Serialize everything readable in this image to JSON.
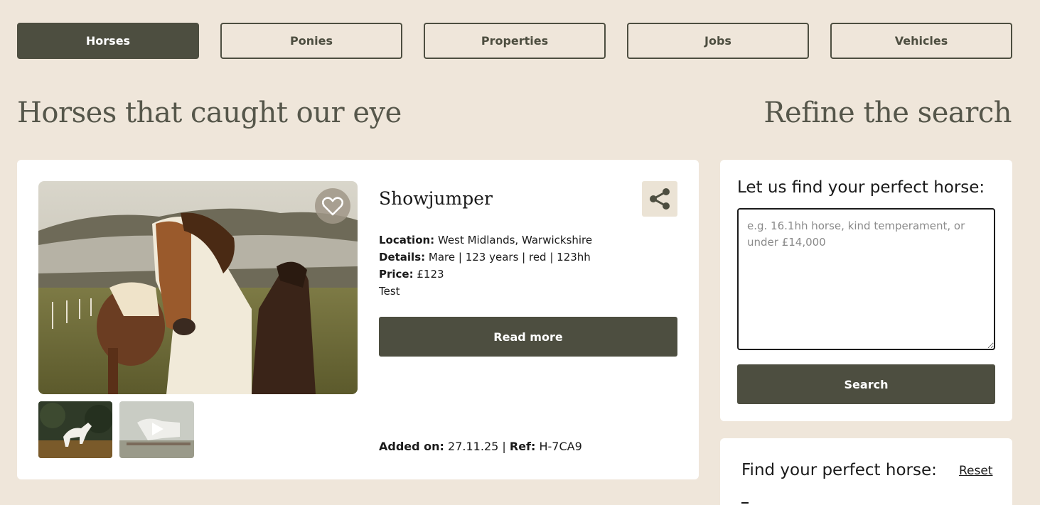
{
  "tabs": [
    {
      "label": "Horses",
      "active": true
    },
    {
      "label": "Ponies",
      "active": false
    },
    {
      "label": "Properties",
      "active": false
    },
    {
      "label": "Jobs",
      "active": false
    },
    {
      "label": "Vehicles",
      "active": false
    }
  ],
  "headings": {
    "left": "Horses that caught our eye",
    "right": "Refine the search"
  },
  "listing": {
    "title": "Showjumper",
    "location_label": "Location:",
    "location": "West Midlands, Warwickshire",
    "details_label": "Details:",
    "details": "Mare | 123 years | red | 123hh",
    "price_label": "Price:",
    "price": "£123",
    "note": "Test",
    "read_more": "Read more",
    "added_label": "Added on:",
    "added": "27.11.25",
    "separator": "|",
    "ref_label": "Ref:",
    "ref": "H-7CA9",
    "icons": {
      "favourite": "heart-icon",
      "share": "share-icon",
      "play": "play-icon"
    }
  },
  "search": {
    "title": "Let us find your perfect horse:",
    "placeholder": "e.g. 16.1hh horse, kind temperament, or under £14,000",
    "button": "Search"
  },
  "filter": {
    "title": "Find your perfect horse:",
    "reset": "Reset"
  },
  "colors": {
    "background": "#efe6da",
    "primary": "#4d4e40",
    "panel": "#ffffff"
  }
}
